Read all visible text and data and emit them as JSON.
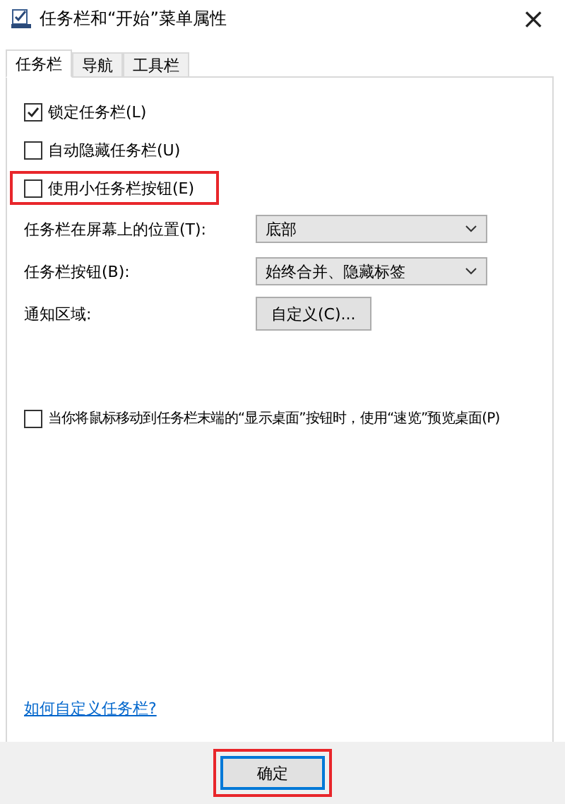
{
  "window": {
    "title": "任务栏和“开始”菜单属性",
    "close": "×"
  },
  "tabs": [
    {
      "label": "任务栏",
      "selected": true
    },
    {
      "label": "导航",
      "selected": false
    },
    {
      "label": "工具栏",
      "selected": false
    }
  ],
  "options": [
    {
      "label": "锁定任务栏(L)",
      "checked": true,
      "highlighted": false
    },
    {
      "label": "自动隐藏任务栏(U)",
      "checked": false,
      "highlighted": false
    },
    {
      "label": "使用小任务栏按钮(E)",
      "checked": false,
      "highlighted": true
    }
  ],
  "settings": [
    {
      "kind": "dropdown",
      "label": "任务栏在屏幕上的位置(T):",
      "value": "底部"
    },
    {
      "kind": "dropdown",
      "label": "任务栏按钮(B):",
      "value": "始终合并、隐藏标签"
    },
    {
      "kind": "button",
      "label": "通知区域:",
      "value": "自定义(C)..."
    }
  ],
  "peek_option": {
    "label": "当你将鼠标移动到任务栏末端的“显示桌面”按钮时，使用“速览”预览桌面(P)",
    "checked": false
  },
  "help_link": "如何自定义任务栏?",
  "ok_button": {
    "label": "确定",
    "highlighted": true
  }
}
